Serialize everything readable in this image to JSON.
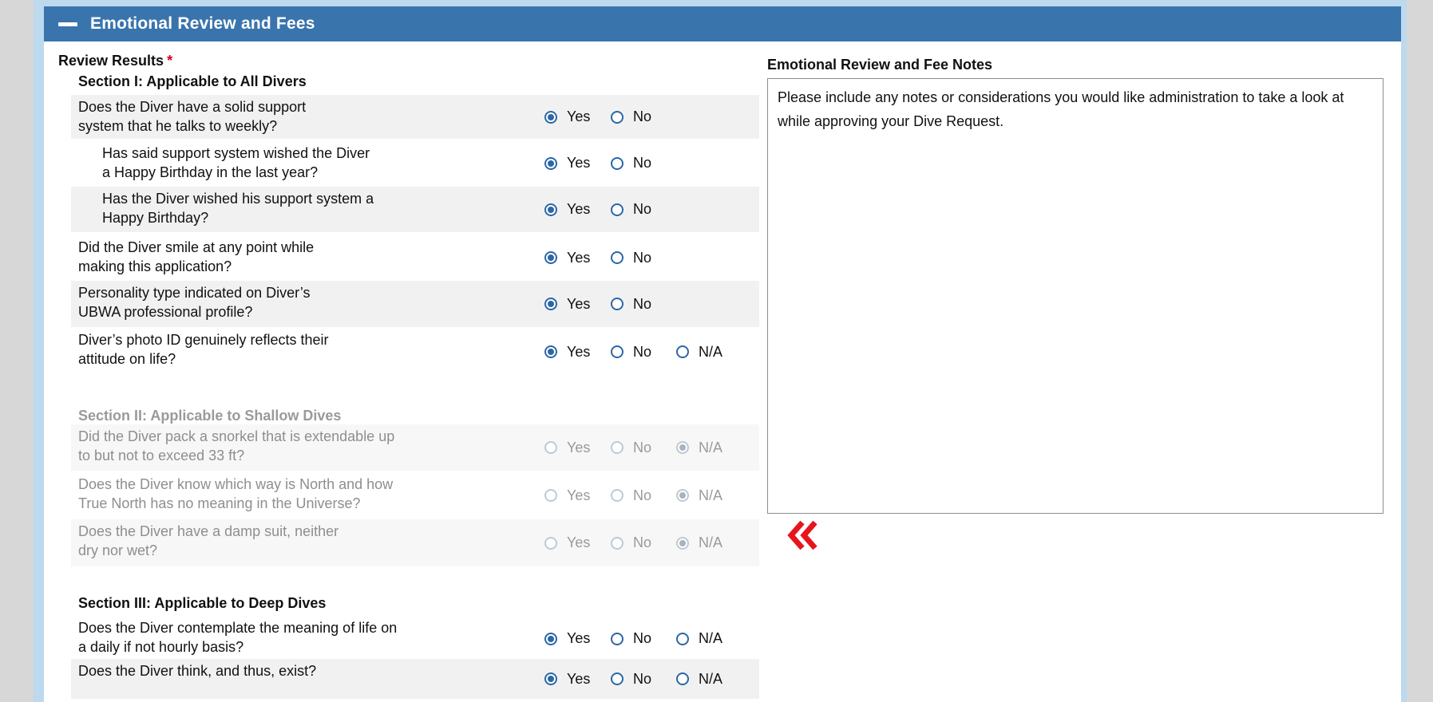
{
  "panel": {
    "title": "Emotional Review and Fees"
  },
  "review": {
    "label": "Review Results",
    "required_mark": "*"
  },
  "options": {
    "yes": "Yes",
    "no": "No",
    "na": "N/A"
  },
  "sections": [
    {
      "title": "Section I: Applicable to All Divers",
      "disabled": false,
      "questions": [
        {
          "lines": [
            "Does the Diver have a solid support",
            "system that he talks to weekly?"
          ],
          "selected": "yes",
          "has_na": false
        },
        {
          "lines": [
            "Has said support system wished the Diver",
            "a Happy Birthday in the last year?"
          ],
          "selected": "yes",
          "has_na": false
        },
        {
          "lines": [
            "Has the Diver wished his support system a",
            "Happy Birthday?"
          ],
          "selected": "yes",
          "has_na": false
        },
        {
          "lines": [
            "Did the Diver smile at any point while",
            "making this application?"
          ],
          "selected": "yes",
          "has_na": false
        },
        {
          "lines": [
            "Personality type indicated on Diver’s",
            "UBWA professional profile?"
          ],
          "selected": "yes",
          "has_na": false
        },
        {
          "lines": [
            "Diver’s photo ID genuinely reflects their",
            "attitude on life?"
          ],
          "selected": "yes",
          "has_na": true
        }
      ]
    },
    {
      "title": "Section II: Applicable to Shallow Dives",
      "disabled": true,
      "questions": [
        {
          "lines": [
            "Did the Diver pack a snorkel that is extendable up",
            "to but not to exceed 33 ft?"
          ],
          "selected": "na",
          "has_na": true
        },
        {
          "lines": [
            "Does the Diver know which way is North and how",
            "True North has no meaning in the Universe?"
          ],
          "selected": "na",
          "has_na": true
        },
        {
          "lines": [
            "Does the Diver have a damp suit, neither",
            "dry nor wet?"
          ],
          "selected": "na",
          "has_na": true
        }
      ]
    },
    {
      "title": "Section III:  Applicable to Deep Dives",
      "disabled": false,
      "questions": [
        {
          "lines": [
            "Does the Diver contemplate the meaning of life on",
            "a daily if not hourly basis?"
          ],
          "selected": "yes",
          "has_na": true
        },
        {
          "lines": [
            "Does the Diver think, and thus, exist?"
          ],
          "selected": "yes",
          "has_na": true
        }
      ]
    }
  ],
  "notes": {
    "title": "Emotional Review and Fee Notes",
    "text": "Please include any notes or considerations you would like administration to take a look at while approving your Dive Request."
  },
  "icons": {
    "collapse": "minus-icon",
    "marker": "double-chevron-left-icon"
  },
  "colors": {
    "header": "#3a74ac",
    "radio": "#2c67a6",
    "marker": "#e8141c"
  }
}
